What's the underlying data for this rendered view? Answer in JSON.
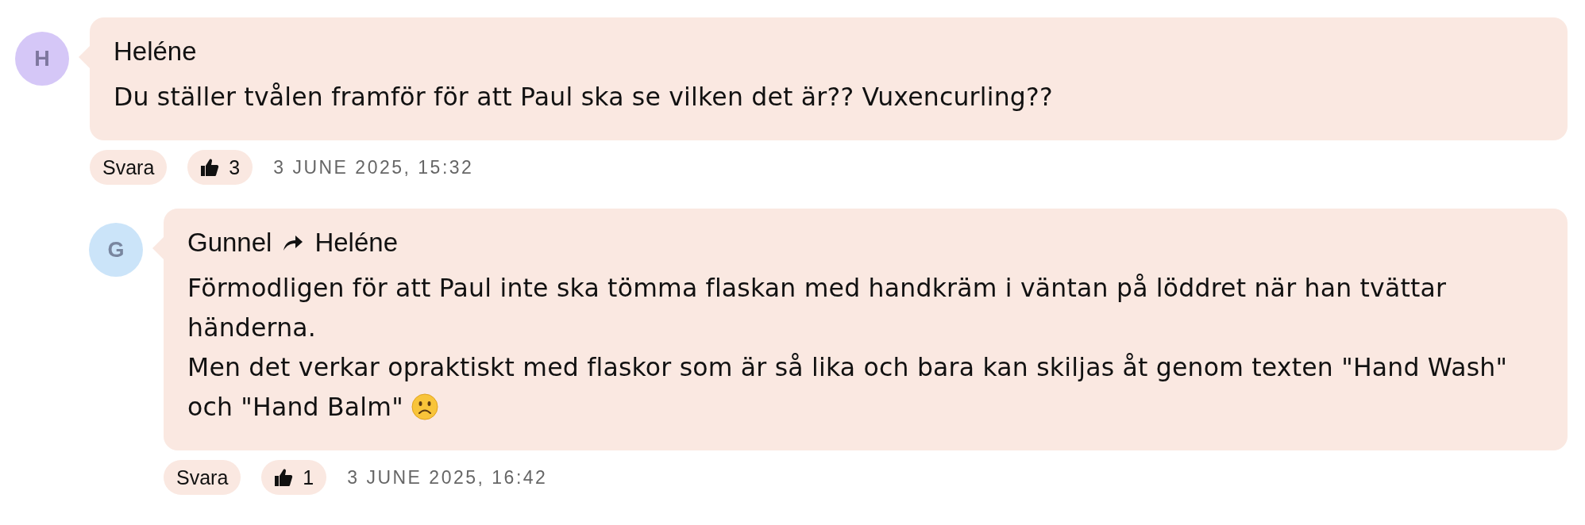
{
  "comments": [
    {
      "initial": "H",
      "color": "#d5c7f7",
      "author": "Heléne",
      "paragraphs": [
        "Du ställer tvålen framför för att Paul ska se vilken det är?? Vuxencurling??"
      ],
      "reply_button": "Svara",
      "likes": "3",
      "timestamp": "3 JUNE 2025, 15:32",
      "children": [
        {
          "initial": "G",
          "color": "#cbe4f9",
          "author": "Gunnel",
          "reply_to": "Heléne",
          "paragraphs": [
            "Förmodligen för att Paul inte ska tömma flaskan med handkräm i väntan på löddret när han tvättar händerna.",
            "Men det verkar opraktiskt med flaskor som är så lika och bara kan skiljas åt genom texten \"Hand Wash\" och \"Hand Balm\""
          ],
          "emoji_after": true,
          "reply_button": "Svara",
          "likes": "1",
          "timestamp": "3 JUNE 2025, 16:42"
        }
      ]
    }
  ]
}
